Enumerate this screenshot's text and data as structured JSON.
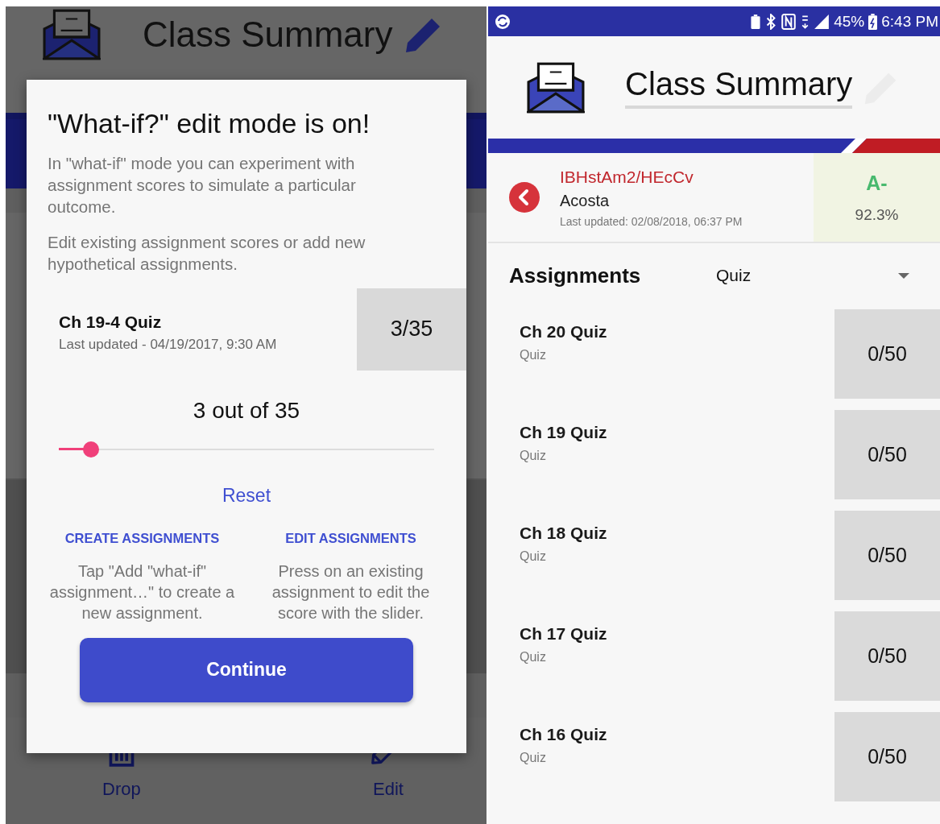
{
  "left_screen": {
    "header": {
      "title": "Class Summary"
    },
    "toolbar": [
      {
        "kind": "trash",
        "label": "Drop"
      },
      {
        "kind": "pencil",
        "label": "Edit"
      }
    ],
    "dialog": {
      "title": "\"What-if?\" edit mode is on!",
      "paragraphs": [
        "In \"what-if\" mode you can experiment with assignment scores to simulate a particular outcome.",
        "Edit existing assignment scores or add new hypothetical assignments."
      ],
      "assignment": {
        "name": "Ch 19-4 Quiz",
        "updated": "Last updated - 04/19/2017, 9:30 AM",
        "score": "3/35"
      },
      "slider": {
        "reading": "3 out of 35",
        "level": 0.086
      },
      "reset": "Reset",
      "help": [
        {
          "heading": "CREATE ASSIGNMENTS",
          "text": "Tap \"Add \"what-if\" assignment…\" to create a new assignment."
        },
        {
          "heading": "EDIT ASSIGNMENTS",
          "text": "Press on an existing assignment to edit the score with the slider."
        }
      ],
      "continue": "Continue"
    }
  },
  "right_screen": {
    "status_bar": {
      "battery": "45%",
      "time": "6:43 PM"
    },
    "header": {
      "title": "Class Summary"
    },
    "student": {
      "class": "IBHstAm2/HEcCv",
      "name": "Acosta",
      "updated": "Last updated: 02/08/2018, 06:37 PM",
      "grade": "A-",
      "percent": "92.3%"
    },
    "assignments": {
      "title": "Assignments",
      "filter": "Quiz",
      "items": [
        {
          "name": "Ch 20 Quiz",
          "type": "Quiz",
          "score": "0/50"
        },
        {
          "name": "Ch 19 Quiz",
          "type": "Quiz",
          "score": "0/50"
        },
        {
          "name": "Ch 18 Quiz",
          "type": "Quiz",
          "score": "0/50"
        },
        {
          "name": "Ch 17 Quiz",
          "type": "Quiz",
          "score": "0/50"
        },
        {
          "name": "Ch 16 Quiz",
          "type": "Quiz",
          "score": "0/50"
        }
      ]
    }
  }
}
